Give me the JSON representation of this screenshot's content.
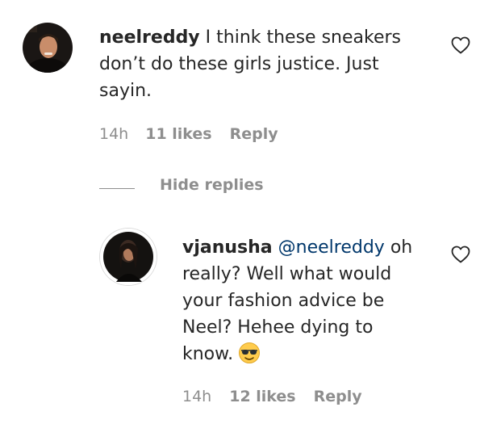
{
  "comment": {
    "username": "neelreddy",
    "text_line1": " I think these sneakers",
    "text_line2": "don’t do these girls justice. Just",
    "text_line3": "sayin.",
    "time": "14h",
    "likes": "11 likes",
    "reply_label": "Reply"
  },
  "hide_replies_label": "Hide replies",
  "reply": {
    "username": "vjanusha",
    "mention": "@neelreddy",
    "text_line1_rest": " oh",
    "text_line2": "really? Well what would",
    "text_line3": "your fashion advice be",
    "text_line4": "Neel? Hehee dying to",
    "text_line5": "know.",
    "emoji_name": "sunglasses-face-emoji",
    "time": "14h",
    "likes": "12 likes",
    "reply_label": "Reply"
  },
  "icons": {
    "like": "heart-outline-icon"
  },
  "colors": {
    "text": "#262626",
    "muted": "#8e8e8e",
    "mention": "#00376b"
  }
}
